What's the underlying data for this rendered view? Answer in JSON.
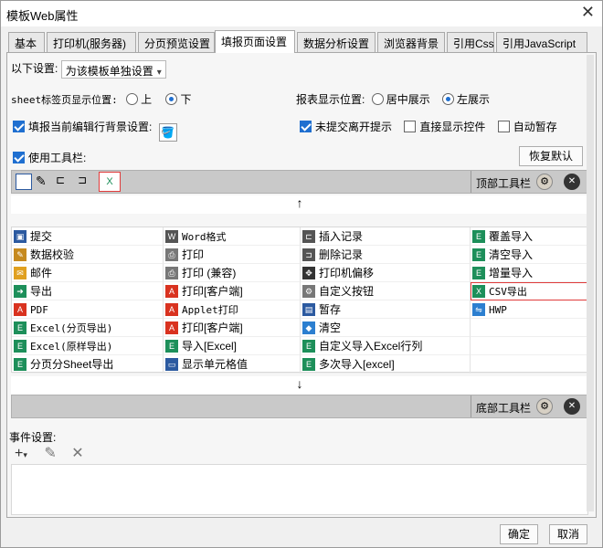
{
  "window": {
    "title": "模板Web属性"
  },
  "tabs": [
    "基本",
    "打印机(服务器)",
    "分页预览设置",
    "填报页面设置",
    "数据分析设置",
    "浏览器背景",
    "引用Css",
    "引用JavaScript"
  ],
  "settings": {
    "scope_label": "以下设置:",
    "scope_value": "为该模板单独设置",
    "sheet_pos_label": "sheet标签页显示位置:",
    "sheet_top": "上",
    "sheet_bottom": "下",
    "report_pos_label": "报表显示位置:",
    "report_center": "居中展示",
    "report_left": "左展示",
    "fill_bg_label": "填报当前编辑行背景设置:",
    "unsubmitted_label": "未提交离开提示",
    "direct_control_label": "直接显示控件",
    "auto_save_label": "自动暂存",
    "use_toolbar_label": "使用工具栏:",
    "restore_default": "恢复默认",
    "top_toolbar_label": "顶部工具栏",
    "bottom_toolbar_label": "底部工具栏",
    "events_label": "事件设置:"
  },
  "buttons_grid": [
    [
      "提交",
      "Word格式",
      "插入记录",
      "覆盖导入"
    ],
    [
      "数据校验",
      "打印",
      "删除记录",
      "清空导入"
    ],
    [
      "邮件",
      "打印 (兼容)",
      "打印机偏移",
      "增量导入"
    ],
    [
      "导出",
      "打印[客户端]",
      "自定义按钮",
      "CSV导出"
    ],
    [
      "PDF",
      "Applet打印",
      "暂存",
      "HWP"
    ],
    [
      "Excel(分页导出)",
      "打印[客户端]",
      "清空",
      ""
    ],
    [
      "Excel(原样导出)",
      "导入[Excel]",
      "自定义导入Excel行列",
      ""
    ],
    [
      "分页分Sheet导出",
      "显示单元格值",
      "多次导入[excel]",
      ""
    ]
  ],
  "icons_grid": [
    [
      "submit-icon",
      "word-icon",
      "insert-record-icon",
      "excel-import-icon"
    ],
    [
      "validate-icon",
      "print-icon",
      "delete-record-icon",
      "excel-import-icon"
    ],
    [
      "mail-icon",
      "print-icon",
      "printer-offset-icon",
      "excel-import-icon"
    ],
    [
      "export-icon",
      "pdf-icon",
      "gear-icon",
      "csv-icon"
    ],
    [
      "pdf-icon",
      "pdf-icon",
      "save-draft-icon",
      "hwp-icon"
    ],
    [
      "excel-icon",
      "pdf-icon",
      "eraser-icon",
      ""
    ],
    [
      "excel-icon",
      "excel-icon",
      "excel-icon",
      ""
    ],
    [
      "excel-icon",
      "cell-value-icon",
      "excel-icon",
      ""
    ]
  ],
  "footer": {
    "ok": "确定",
    "cancel": "取消"
  },
  "colors": {
    "accent": "#1f6fd0",
    "highlight_border": "#e03b3b",
    "toolbar": "#c9c9c9",
    "excel_green": "#1d8f5a",
    "pdf_red": "#d9321f"
  }
}
